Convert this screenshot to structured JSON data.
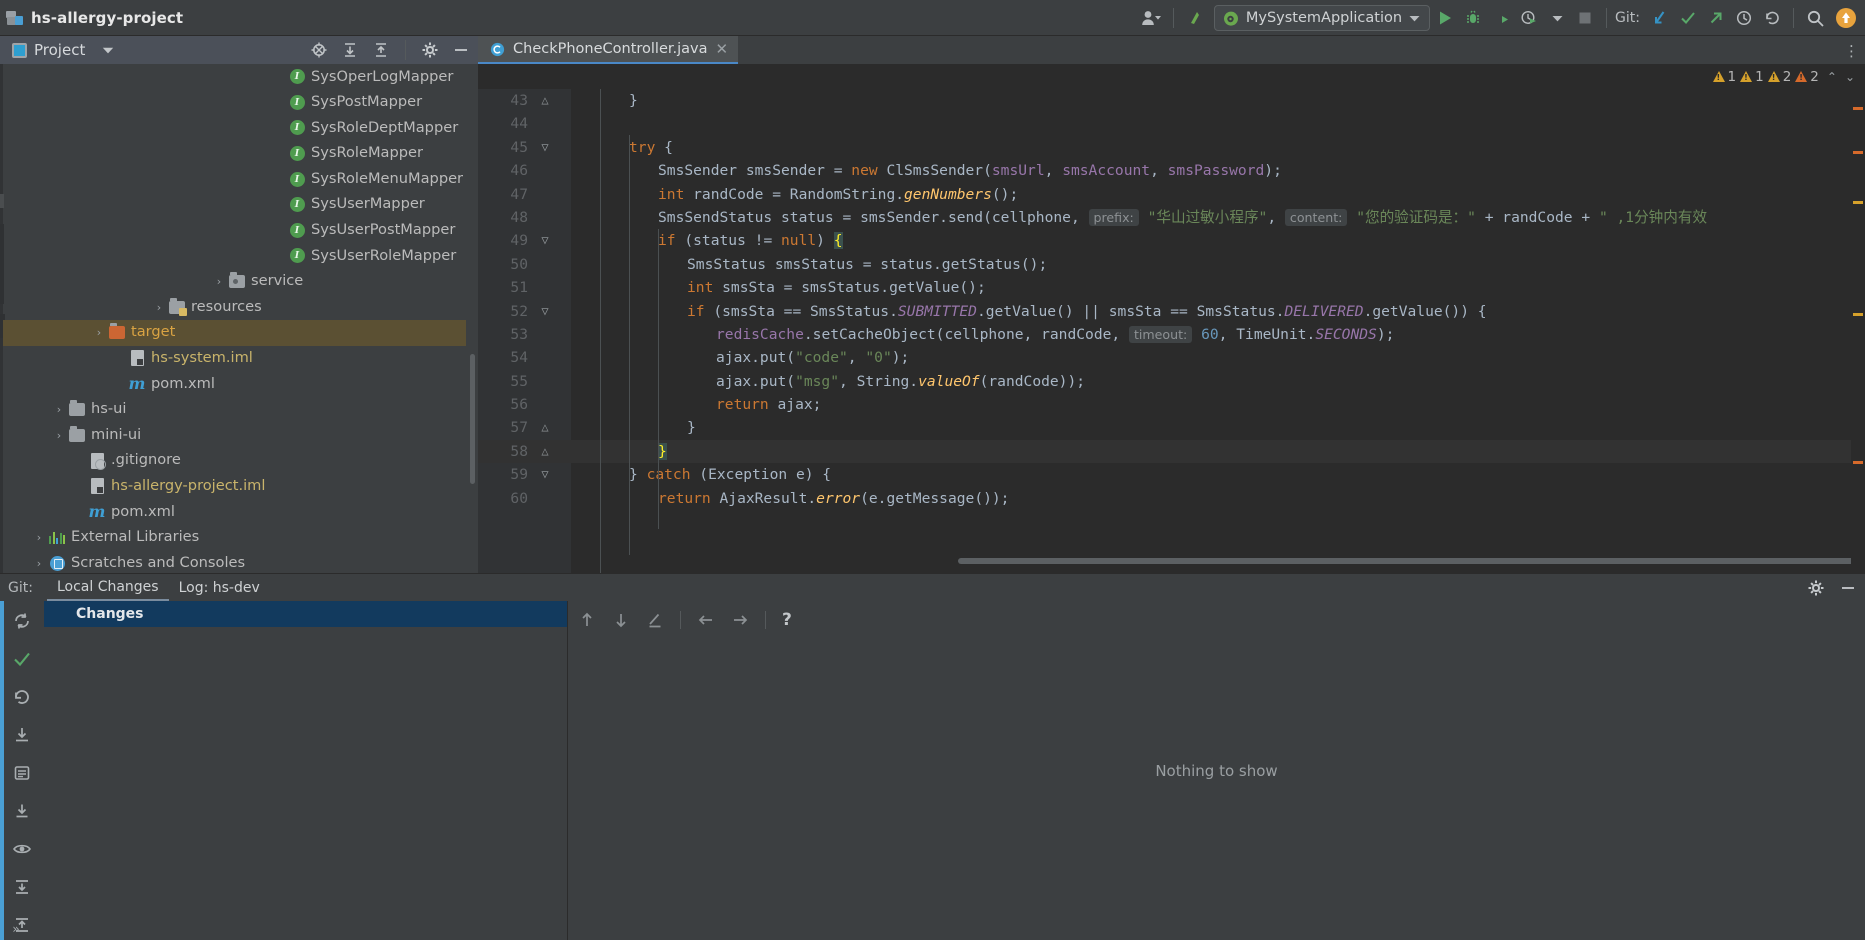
{
  "window": {
    "project_title": "hs-allergy-project",
    "project_icon": "project-logo-icon"
  },
  "toolbar": {
    "user_icon": "user-avatar-icon",
    "update_icon": "update-project-icon",
    "run_config_name": "MySystemApplication",
    "run_config_icon": "spring-boot-icon",
    "run_icon": "run-icon",
    "debug_icon": "debug-icon",
    "run_coverage_icon": "run-with-coverage-icon",
    "profile_icon": "profiler-icon",
    "stop_icon": "stop-icon",
    "git_label": "Git:",
    "git_update_icon": "git-update-project-icon",
    "git_commit_icon": "git-commit-icon",
    "git_push_icon": "git-push-icon",
    "git_history_icon": "git-history-icon",
    "git_rollback_icon": "git-rollback-icon",
    "search_icon": "search-everywhere-icon",
    "notification_icon": "notification-icon"
  },
  "project_tool": {
    "title": "Project",
    "dropdown_icon": "chevron-down-icon",
    "icons": [
      "locate-icon",
      "expand-all-icon",
      "collapse-all-icon",
      "settings-gear-icon",
      "hide-icon"
    ]
  },
  "tabs": {
    "menu_icon": "editor-tabs-menu-icon",
    "items": [
      {
        "label": "CheckPhoneController.java",
        "icon": "java-class-icon",
        "close_icon": "close-icon",
        "active": true
      }
    ]
  },
  "tree": [
    {
      "label": "SysOperLogMapper",
      "icon": "interface-icon",
      "indent": 13,
      "arrow": "",
      "color": "white",
      "selected": false
    },
    {
      "label": "SysPostMapper",
      "icon": "interface-icon",
      "indent": 13,
      "arrow": "",
      "color": "white",
      "selected": false
    },
    {
      "label": "SysRoleDeptMapper",
      "icon": "interface-icon",
      "indent": 13,
      "arrow": "",
      "color": "white",
      "selected": false
    },
    {
      "label": "SysRoleMapper",
      "icon": "interface-icon",
      "indent": 13,
      "arrow": "",
      "color": "white",
      "selected": false
    },
    {
      "label": "SysRoleMenuMapper",
      "icon": "interface-icon",
      "indent": 13,
      "arrow": "",
      "color": "white",
      "selected": false
    },
    {
      "label": "SysUserMapper",
      "icon": "interface-icon",
      "indent": 13,
      "arrow": "",
      "color": "white",
      "selected": false
    },
    {
      "label": "SysUserPostMapper",
      "icon": "interface-icon",
      "indent": 13,
      "arrow": "",
      "color": "white",
      "selected": false
    },
    {
      "label": "SysUserRoleMapper",
      "icon": "interface-icon",
      "indent": 13,
      "arrow": "",
      "color": "white",
      "selected": false
    },
    {
      "label": "service",
      "icon": "package-folder-icon",
      "indent": 10,
      "arrow": "›",
      "color": "white",
      "selected": false
    },
    {
      "label": "resources",
      "icon": "resources-folder-icon",
      "indent": 7,
      "arrow": "›",
      "color": "white",
      "selected": false
    },
    {
      "label": "target",
      "icon": "target-folder-icon",
      "indent": 4,
      "arrow": "›",
      "color": "orange",
      "selected": true
    },
    {
      "label": "hs-system.iml",
      "icon": "iml-file-icon",
      "indent": 5,
      "arrow": "",
      "color": "yellow",
      "selected": false
    },
    {
      "label": "pom.xml",
      "icon": "maven-icon",
      "indent": 5,
      "arrow": "",
      "color": "white",
      "selected": false
    },
    {
      "label": "hs-ui",
      "icon": "folder-icon",
      "indent": 2,
      "arrow": "›",
      "color": "white",
      "selected": false
    },
    {
      "label": "mini-ui",
      "icon": "folder-icon",
      "indent": 2,
      "arrow": "›",
      "color": "white",
      "selected": false
    },
    {
      "label": ".gitignore",
      "icon": "gitignore-file-icon",
      "indent": 3,
      "arrow": "",
      "color": "white",
      "selected": false
    },
    {
      "label": "hs-allergy-project.iml",
      "icon": "iml-file-icon",
      "indent": 3,
      "arrow": "",
      "color": "yellow",
      "selected": false
    },
    {
      "label": "pom.xml",
      "icon": "maven-icon",
      "indent": 3,
      "arrow": "",
      "color": "white",
      "selected": false
    },
    {
      "label": "External Libraries",
      "icon": "libraries-icon",
      "indent": 1,
      "arrow": "›",
      "color": "white",
      "selected": false
    },
    {
      "label": "Scratches and Consoles",
      "icon": "scratches-icon",
      "indent": 1,
      "arrow": "›",
      "color": "white",
      "selected": false
    }
  ],
  "editor": {
    "inspections": [
      {
        "level": "warning",
        "count": "1"
      },
      {
        "level": "warning",
        "count": "1"
      },
      {
        "level": "warning",
        "count": "2"
      },
      {
        "level": "error",
        "count": "2"
      }
    ],
    "inspection_up_icon": "prev-problem-icon",
    "inspection_down_icon": "next-problem-icon",
    "lines": [
      {
        "no": "43",
        "fold": "end",
        "indent": 2,
        "tokens": [
          {
            "t": "}",
            "c": "p"
          }
        ]
      },
      {
        "no": "44",
        "fold": "",
        "indent": 0,
        "tokens": []
      },
      {
        "no": "45",
        "fold": "start",
        "indent": 2,
        "tokens": [
          {
            "t": "try",
            "c": "k"
          },
          {
            "t": " {",
            "c": "p"
          }
        ]
      },
      {
        "no": "46",
        "fold": "",
        "indent": 3,
        "tokens": [
          {
            "t": "SmsSender smsSender = ",
            "c": "p"
          },
          {
            "t": "new",
            "c": "k"
          },
          {
            "t": " ClSmsSender(",
            "c": "p"
          },
          {
            "t": "smsUrl",
            "c": "id"
          },
          {
            "t": ", ",
            "c": "p"
          },
          {
            "t": "smsAccount",
            "c": "id"
          },
          {
            "t": ", ",
            "c": "p"
          },
          {
            "t": "smsPassword",
            "c": "id"
          },
          {
            "t": ");",
            "c": "p"
          }
        ]
      },
      {
        "no": "47",
        "fold": "",
        "indent": 3,
        "tokens": [
          {
            "t": "int",
            "c": "k"
          },
          {
            "t": " randCode = RandomString.",
            "c": "p"
          },
          {
            "t": "genNumbers",
            "c": "fi"
          },
          {
            "t": "();",
            "c": "p"
          }
        ]
      },
      {
        "no": "48",
        "fold": "",
        "indent": 3,
        "tokens": [
          {
            "t": "SmsSendStatus status = smsSender.send(cellphone, ",
            "c": "p"
          },
          {
            "t": "prefix:",
            "c": "hint"
          },
          {
            "t": " ",
            "c": "p"
          },
          {
            "t": "\"华山过敏小程序\"",
            "c": "s"
          },
          {
            "t": ", ",
            "c": "p"
          },
          {
            "t": "content:",
            "c": "hint"
          },
          {
            "t": " ",
            "c": "p"
          },
          {
            "t": "\"您的验证码是：\"",
            "c": "s"
          },
          {
            "t": " + randCode + ",
            "c": "p"
          },
          {
            "t": "\"",
            "c": "s"
          },
          {
            "t": " ,1分钟内有效",
            "c": "s"
          }
        ]
      },
      {
        "no": "49",
        "fold": "start",
        "indent": 3,
        "tokens": [
          {
            "t": "if",
            "c": "k"
          },
          {
            "t": " (status != ",
            "c": "p"
          },
          {
            "t": "null",
            "c": "k"
          },
          {
            "t": ") ",
            "c": "p"
          },
          {
            "t": "{",
            "c": "brace"
          }
        ]
      },
      {
        "no": "50",
        "fold": "",
        "indent": 4,
        "tokens": [
          {
            "t": "SmsStatus smsStatus = status.getStatus();",
            "c": "p"
          }
        ]
      },
      {
        "no": "51",
        "fold": "",
        "indent": 4,
        "tokens": [
          {
            "t": "int",
            "c": "k"
          },
          {
            "t": " smsSta = smsStatus.getValue();",
            "c": "p"
          }
        ]
      },
      {
        "no": "52",
        "fold": "start",
        "indent": 4,
        "tokens": [
          {
            "t": "if",
            "c": "k"
          },
          {
            "t": " (smsSta == SmsStatus.",
            "c": "p"
          },
          {
            "t": "SUBMITTED",
            "c": "si"
          },
          {
            "t": ".getValue() || smsSta == SmsStatus.",
            "c": "p"
          },
          {
            "t": "DELIVERED",
            "c": "si"
          },
          {
            "t": ".getValue()) {",
            "c": "p"
          }
        ]
      },
      {
        "no": "53",
        "fold": "",
        "indent": 5,
        "tokens": [
          {
            "t": "redisCache",
            "c": "id"
          },
          {
            "t": ".setCacheObject(cellphone, randCode, ",
            "c": "p"
          },
          {
            "t": "timeout:",
            "c": "hint"
          },
          {
            "t": " ",
            "c": "p"
          },
          {
            "t": "60",
            "c": "n"
          },
          {
            "t": ", TimeUnit.",
            "c": "p"
          },
          {
            "t": "SECONDS",
            "c": "si"
          },
          {
            "t": ");",
            "c": "p"
          }
        ]
      },
      {
        "no": "54",
        "fold": "",
        "indent": 5,
        "tokens": [
          {
            "t": "ajax.put(",
            "c": "p"
          },
          {
            "t": "\"code\"",
            "c": "s"
          },
          {
            "t": ", ",
            "c": "p"
          },
          {
            "t": "\"0\"",
            "c": "s"
          },
          {
            "t": ");",
            "c": "p"
          }
        ]
      },
      {
        "no": "55",
        "fold": "",
        "indent": 5,
        "tokens": [
          {
            "t": "ajax.put(",
            "c": "p"
          },
          {
            "t": "\"msg\"",
            "c": "s"
          },
          {
            "t": ", String.",
            "c": "p"
          },
          {
            "t": "valueOf",
            "c": "fi"
          },
          {
            "t": "(randCode));",
            "c": "p"
          }
        ]
      },
      {
        "no": "56",
        "fold": "",
        "indent": 5,
        "tokens": [
          {
            "t": "return",
            "c": "k"
          },
          {
            "t": " ajax;",
            "c": "p"
          }
        ]
      },
      {
        "no": "57",
        "fold": "end",
        "indent": 4,
        "tokens": [
          {
            "t": "}",
            "c": "p"
          }
        ]
      },
      {
        "no": "58",
        "fold": "end",
        "indent": 3,
        "tokens": [
          {
            "t": "}",
            "c": "brace"
          }
        ],
        "highlight": true
      },
      {
        "no": "59",
        "fold": "start",
        "indent": 2,
        "tokens": [
          {
            "t": "} ",
            "c": "p"
          },
          {
            "t": "catch",
            "c": "k"
          },
          {
            "t": " (Exception e) {",
            "c": "p"
          }
        ]
      },
      {
        "no": "60",
        "fold": "",
        "indent": 3,
        "tokens": [
          {
            "t": "return",
            "c": "k"
          },
          {
            "t": " AjaxResult.",
            "c": "p"
          },
          {
            "t": "error",
            "c": "fi"
          },
          {
            "t": "(e.getMessage());",
            "c": "p"
          }
        ]
      }
    ]
  },
  "git_panel": {
    "label": "Git:",
    "tabs": [
      {
        "label": "Local Changes",
        "active": true
      },
      {
        "label": "Log: hs-dev",
        "active": false
      }
    ],
    "settings_icon": "settings-gear-icon",
    "hide_icon": "hide-panel-icon",
    "changes_header": "Changes",
    "side_icons": [
      "refresh-icon",
      "commit-check-icon",
      "rollback-icon",
      "shelve-icon",
      "group-icon",
      "download-icon",
      "preview-eye-icon",
      "collapse-icon",
      "expand-icon"
    ],
    "diff_toolbar_icons": [
      "previous-difference-icon",
      "next-difference-icon",
      "edit-source-icon",
      "arrow-left-icon",
      "arrow-right-icon",
      "help-icon"
    ],
    "empty_state": "Nothing to show",
    "expand_bottom_icon": "expand-arrows-icon"
  }
}
